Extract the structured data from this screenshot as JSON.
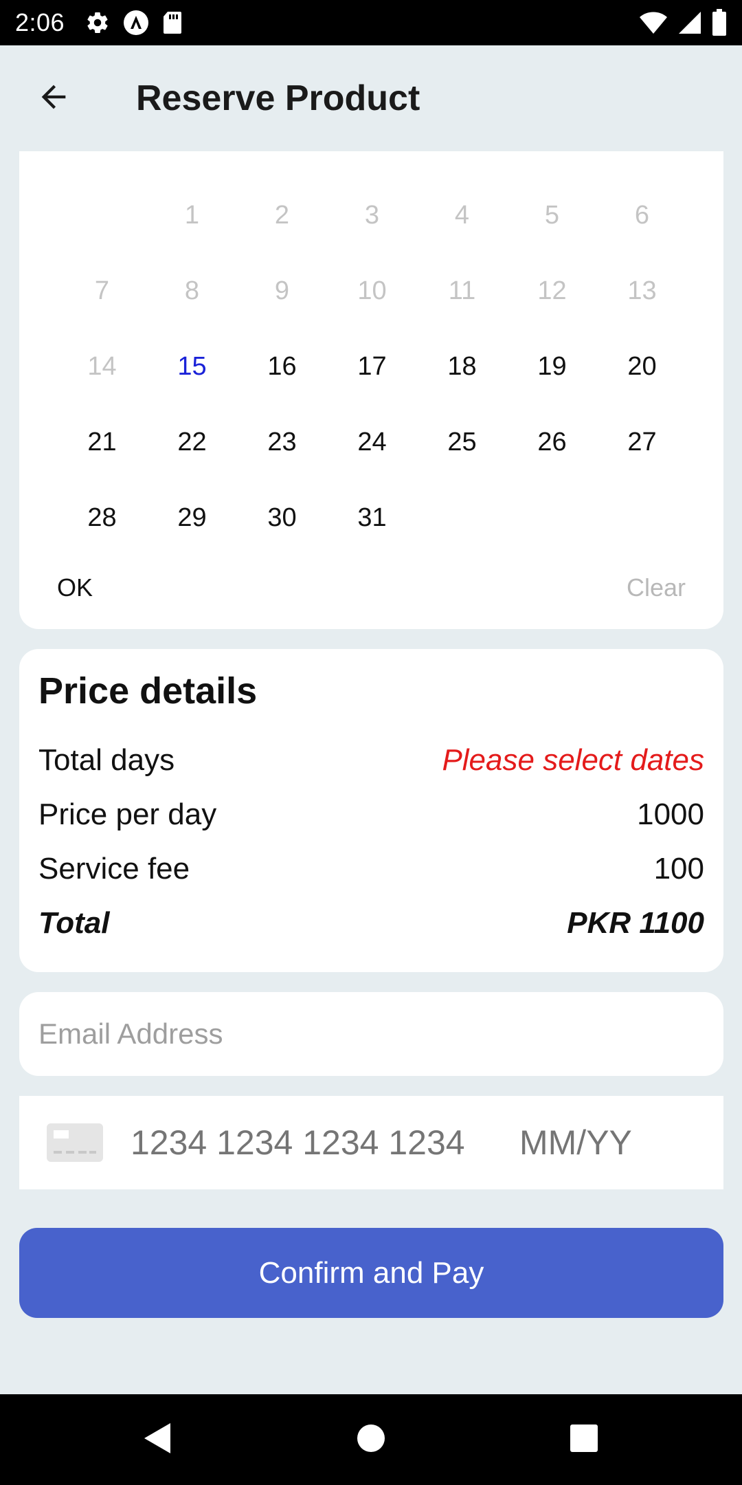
{
  "status_bar": {
    "time": "2:06",
    "icons_left": [
      "gear-icon",
      "a-logo-icon",
      "sd-card-icon"
    ],
    "icons_right": [
      "wifi-icon",
      "signal-icon",
      "battery-icon"
    ]
  },
  "app_bar": {
    "back_icon": "arrow-left-icon",
    "title": "Reserve Product"
  },
  "calendar": {
    "weeks": [
      [
        {
          "label": "",
          "state": "empty"
        },
        {
          "label": "1",
          "state": "disabled"
        },
        {
          "label": "2",
          "state": "disabled"
        },
        {
          "label": "3",
          "state": "disabled"
        },
        {
          "label": "4",
          "state": "disabled"
        },
        {
          "label": "5",
          "state": "disabled"
        },
        {
          "label": "6",
          "state": "disabled"
        }
      ],
      [
        {
          "label": "7",
          "state": "disabled"
        },
        {
          "label": "8",
          "state": "disabled"
        },
        {
          "label": "9",
          "state": "disabled"
        },
        {
          "label": "10",
          "state": "disabled"
        },
        {
          "label": "11",
          "state": "disabled"
        },
        {
          "label": "12",
          "state": "disabled"
        },
        {
          "label": "13",
          "state": "disabled"
        }
      ],
      [
        {
          "label": "14",
          "state": "disabled"
        },
        {
          "label": "15",
          "state": "today"
        },
        {
          "label": "16",
          "state": "enabled"
        },
        {
          "label": "17",
          "state": "enabled"
        },
        {
          "label": "18",
          "state": "enabled"
        },
        {
          "label": "19",
          "state": "enabled"
        },
        {
          "label": "20",
          "state": "enabled"
        }
      ],
      [
        {
          "label": "21",
          "state": "enabled"
        },
        {
          "label": "22",
          "state": "enabled"
        },
        {
          "label": "23",
          "state": "enabled"
        },
        {
          "label": "24",
          "state": "enabled"
        },
        {
          "label": "25",
          "state": "enabled"
        },
        {
          "label": "26",
          "state": "enabled"
        },
        {
          "label": "27",
          "state": "enabled"
        }
      ],
      [
        {
          "label": "28",
          "state": "enabled"
        },
        {
          "label": "29",
          "state": "enabled"
        },
        {
          "label": "30",
          "state": "enabled"
        },
        {
          "label": "31",
          "state": "enabled"
        }
      ]
    ],
    "ok_label": "OK",
    "clear_label": "Clear",
    "colors": {
      "today": "#1a22d8",
      "disabled": "#c4c4c4",
      "enabled": "#111111"
    }
  },
  "price_details": {
    "title": "Price details",
    "rows": {
      "total_days": {
        "label": "Total days",
        "value": "Please select dates"
      },
      "price_per_day": {
        "label": "Price per day",
        "value": "1000"
      },
      "service_fee": {
        "label": "Service fee",
        "value": "100"
      },
      "total": {
        "label": "Total",
        "value": "PKR 1100"
      }
    },
    "warning_color": "#e41b1b"
  },
  "email": {
    "placeholder": "Email Address",
    "value": ""
  },
  "card": {
    "icon": "credit-card-icon",
    "number_placeholder": "1234 1234 1234 1234",
    "expiry_placeholder": "MM/YY"
  },
  "confirm_button": {
    "label": "Confirm and Pay",
    "color": "#4862cc"
  },
  "nav_bar": {
    "icons": [
      "back-triangle-icon",
      "home-circle-icon",
      "recents-square-icon"
    ]
  }
}
